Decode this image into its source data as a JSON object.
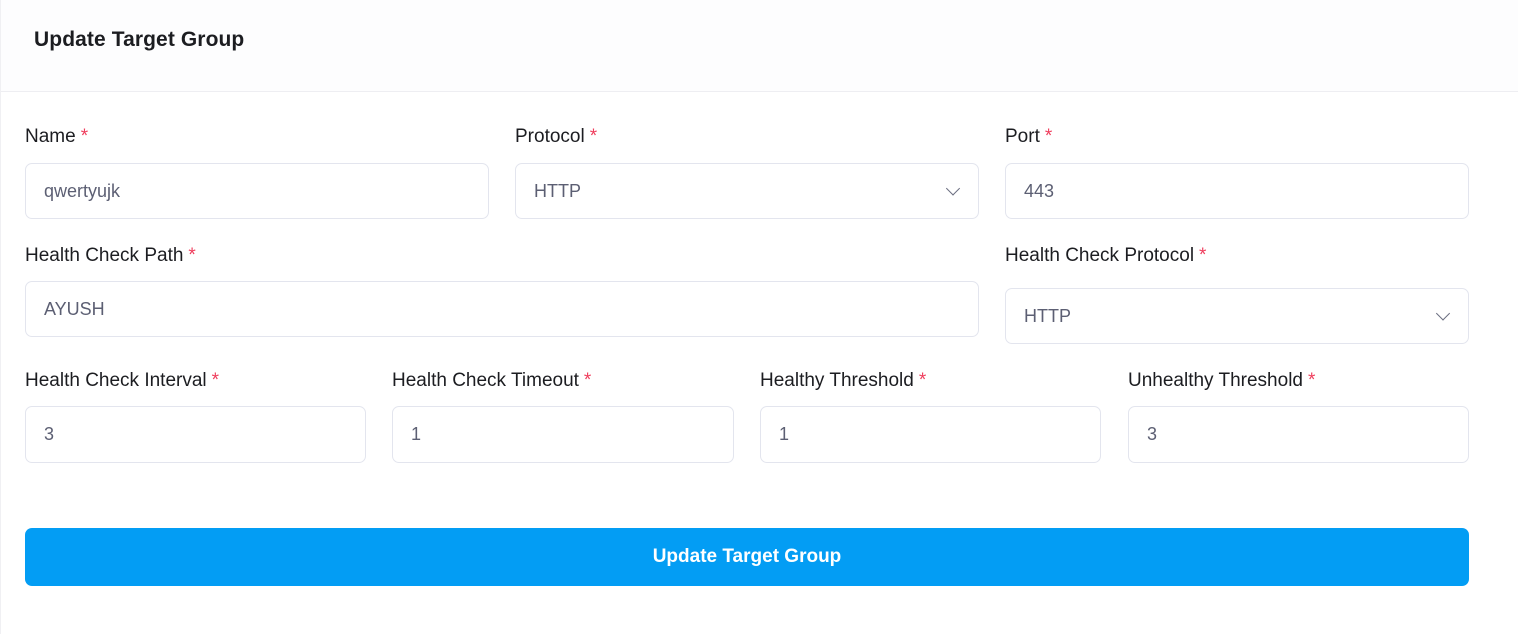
{
  "header": {
    "title": "Update Target Group"
  },
  "required_marker": "*",
  "fields": {
    "name": {
      "label": "Name",
      "value": "qwertyujk"
    },
    "protocol": {
      "label": "Protocol",
      "value": "HTTP"
    },
    "port": {
      "label": "Port",
      "value": "443"
    },
    "health_check_path": {
      "label": "Health Check Path",
      "value": "AYUSH"
    },
    "health_check_protocol": {
      "label": "Health Check Protocol",
      "value": "HTTP"
    },
    "health_check_interval": {
      "label": "Health Check Interval",
      "value": "3"
    },
    "health_check_timeout": {
      "label": "Health Check Timeout",
      "value": "1"
    },
    "healthy_threshold": {
      "label": "Healthy Threshold",
      "value": "1"
    },
    "unhealthy_threshold": {
      "label": "Unhealthy Threshold",
      "value": "3"
    }
  },
  "submit": {
    "label": "Update Target Group"
  },
  "colors": {
    "accent": "#039df4",
    "required": "#ef3e5d"
  }
}
